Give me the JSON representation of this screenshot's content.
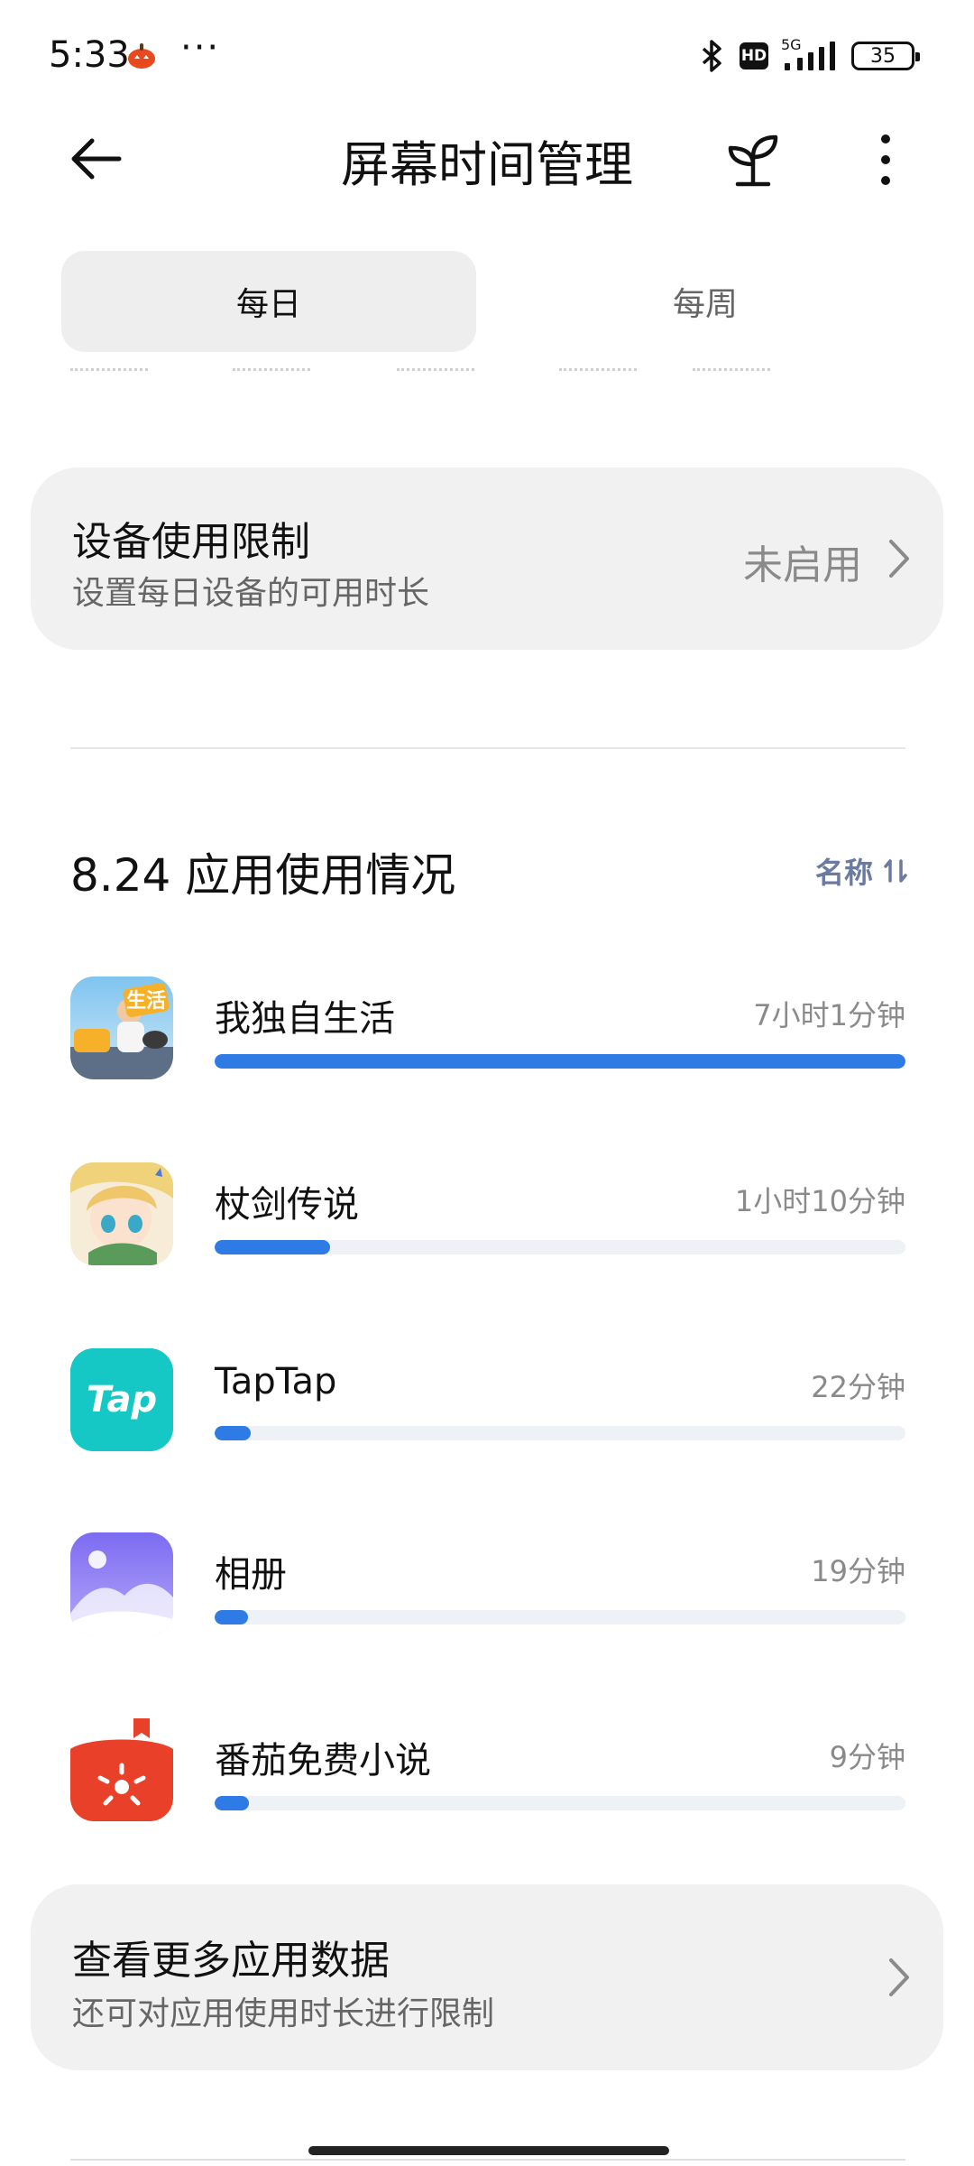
{
  "status_bar": {
    "time": "5:33",
    "more": "···",
    "hd": "HD",
    "network": "5G",
    "battery": "35"
  },
  "header": {
    "title": "屏幕时间管理"
  },
  "tabs": [
    {
      "label": "每日",
      "selected": true
    },
    {
      "label": "每周",
      "selected": false
    }
  ],
  "device_limit": {
    "title": "设备使用限制",
    "subtitle": "设置每日设备的可用时长",
    "status": "未启用"
  },
  "usage": {
    "title": "8.24 应用使用情况",
    "sort_label": "名称"
  },
  "apps": [
    {
      "name": "我独自生活",
      "time": "7小时1分钟",
      "progress": 1.0
    },
    {
      "name": "杖剑传说",
      "time": "1小时10分钟",
      "progress": 0.167
    },
    {
      "name": "TapTap",
      "time": "22分钟",
      "progress": 0.052
    },
    {
      "name": "相册",
      "time": "19分钟",
      "progress": 0.048
    },
    {
      "name": "番茄免费小说",
      "time": "9分钟",
      "progress": 0.05
    }
  ],
  "more_apps": {
    "title": "查看更多应用数据",
    "subtitle": "还可对应用使用时长进行限制"
  },
  "icons": {
    "tap_logo_text": "Tap",
    "game_logo_text": "生活"
  },
  "colors": {
    "accent": "#2f7be6",
    "track": "#eef1f5",
    "card_bg": "#f1f1f1"
  }
}
